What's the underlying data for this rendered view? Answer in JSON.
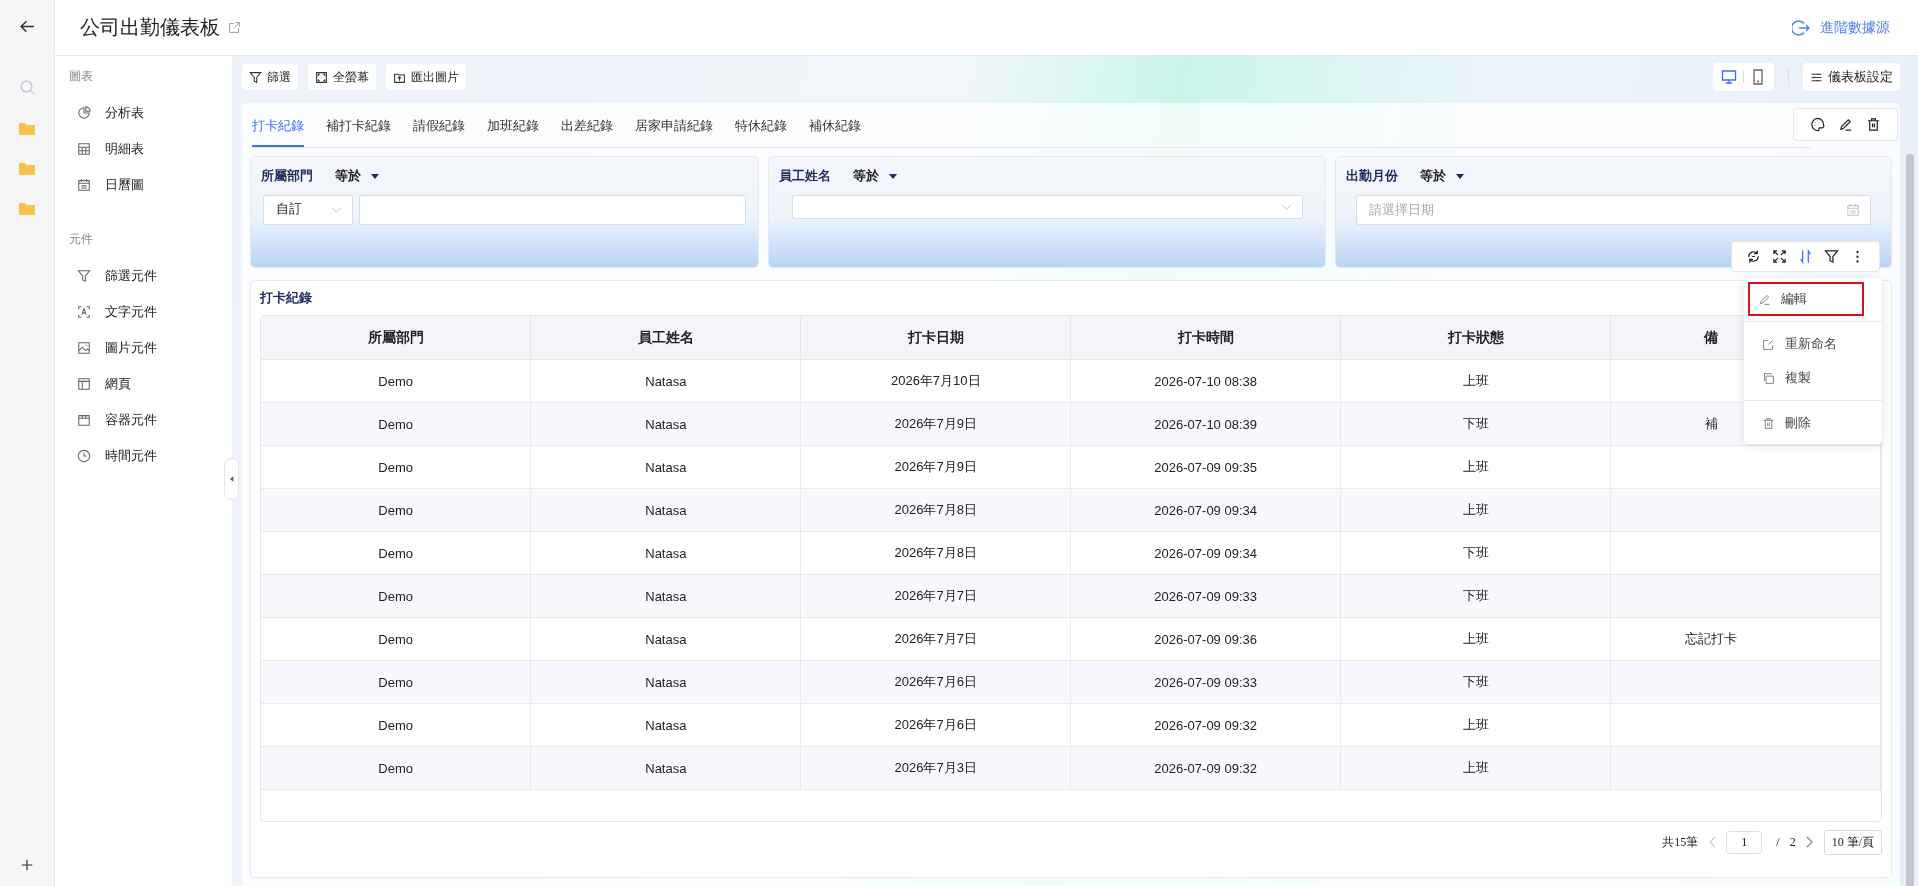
{
  "header": {
    "title": "公司出勤儀表板",
    "advanced_link": "進階數據源"
  },
  "sidebar": {
    "sections": [
      {
        "heading": "圖表",
        "items": [
          {
            "label": "分析表",
            "kind": "pie"
          },
          {
            "label": "明細表",
            "kind": "grid"
          },
          {
            "label": "日曆圖",
            "kind": "calendar"
          }
        ]
      },
      {
        "heading": "元件",
        "items": [
          {
            "label": "篩選元件",
            "kind": "filter"
          },
          {
            "label": "文字元件",
            "kind": "text"
          },
          {
            "label": "圖片元件",
            "kind": "image"
          },
          {
            "label": "網頁",
            "kind": "web"
          },
          {
            "label": "容器元件",
            "kind": "container"
          },
          {
            "label": "時間元件",
            "kind": "clock"
          }
        ]
      }
    ]
  },
  "toolbar": {
    "buttons": [
      {
        "label": "篩選",
        "kind": "filter"
      },
      {
        "label": "全螢幕",
        "kind": "fullscreen"
      },
      {
        "label": "匯出圖片",
        "kind": "export"
      }
    ],
    "devices": [
      {
        "kind": "desktop",
        "selected": true
      },
      {
        "kind": "mobile",
        "selected": false
      }
    ],
    "settings": "儀表板設定"
  },
  "tabs": [
    {
      "label": "打卡紀錄",
      "selected": true
    },
    {
      "label": "補打卡紀錄",
      "selected": false
    },
    {
      "label": "請假紀錄",
      "selected": false
    },
    {
      "label": "加班紀錄",
      "selected": false
    },
    {
      "label": "出差紀錄",
      "selected": false
    },
    {
      "label": "居家申請紀錄",
      "selected": false
    },
    {
      "label": "特休紀錄",
      "selected": false
    },
    {
      "label": "補休紀錄",
      "selected": false
    }
  ],
  "filters": [
    {
      "kind": "custom",
      "label": "所屬部門",
      "operator": "等於",
      "mode": "自訂"
    },
    {
      "kind": "dropdown",
      "label": "員工姓名",
      "operator": "等於"
    },
    {
      "kind": "date",
      "label": "出勤月份",
      "operator": "等於",
      "placeholder": "請選擇日期"
    }
  ],
  "table_widget": {
    "title": "打卡紀錄",
    "columns": [
      "所屬部門",
      "員工姓名",
      "打卡日期",
      "打卡時間",
      "打卡狀態",
      "備"
    ],
    "rows": [
      [
        "Demo",
        "Natasa",
        "2026年7月10日",
        "2026-07-10 08:38",
        "上班",
        ""
      ],
      [
        "Demo",
        "Natasa",
        "2026年7月9日",
        "2026-07-10 08:39",
        "下班",
        "補"
      ],
      [
        "Demo",
        "Natasa",
        "2026年7月9日",
        "2026-07-09 09:35",
        "上班",
        ""
      ],
      [
        "Demo",
        "Natasa",
        "2026年7月8日",
        "2026-07-09 09:34",
        "上班",
        ""
      ],
      [
        "Demo",
        "Natasa",
        "2026年7月8日",
        "2026-07-09 09:34",
        "下班",
        ""
      ],
      [
        "Demo",
        "Natasa",
        "2026年7月7日",
        "2026-07-09 09:33",
        "下班",
        ""
      ],
      [
        "Demo",
        "Natasa",
        "2026年7月7日",
        "2026-07-09 09:36",
        "上班",
        "忘記打卡"
      ],
      [
        "Demo",
        "Natasa",
        "2026年7月6日",
        "2026-07-09 09:33",
        "下班",
        ""
      ],
      [
        "Demo",
        "Natasa",
        "2026年7月6日",
        "2026-07-09 09:32",
        "上班",
        ""
      ],
      [
        "Demo",
        "Natasa",
        "2026年7月3日",
        "2026-07-09 09:32",
        "上班",
        ""
      ]
    ],
    "pagination": {
      "total": "共15筆",
      "page": "1",
      "separator": "/",
      "pages": "2",
      "page_size": "10 筆/頁"
    },
    "tools": [
      {
        "kind": "refresh",
        "active": false
      },
      {
        "kind": "expand",
        "active": false
      },
      {
        "kind": "sort",
        "active": true
      },
      {
        "kind": "filter",
        "active": false
      },
      {
        "kind": "more",
        "active": false
      }
    ]
  },
  "context_menu": {
    "groups": [
      [
        {
          "label": "編輯",
          "kind": "edit",
          "selected": true
        }
      ],
      [
        {
          "label": "重新命名",
          "kind": "rename",
          "selected": false
        },
        {
          "label": "複製",
          "kind": "copy",
          "selected": false
        }
      ],
      [
        {
          "label": "刪除",
          "kind": "trash",
          "selected": false
        }
      ]
    ]
  }
}
